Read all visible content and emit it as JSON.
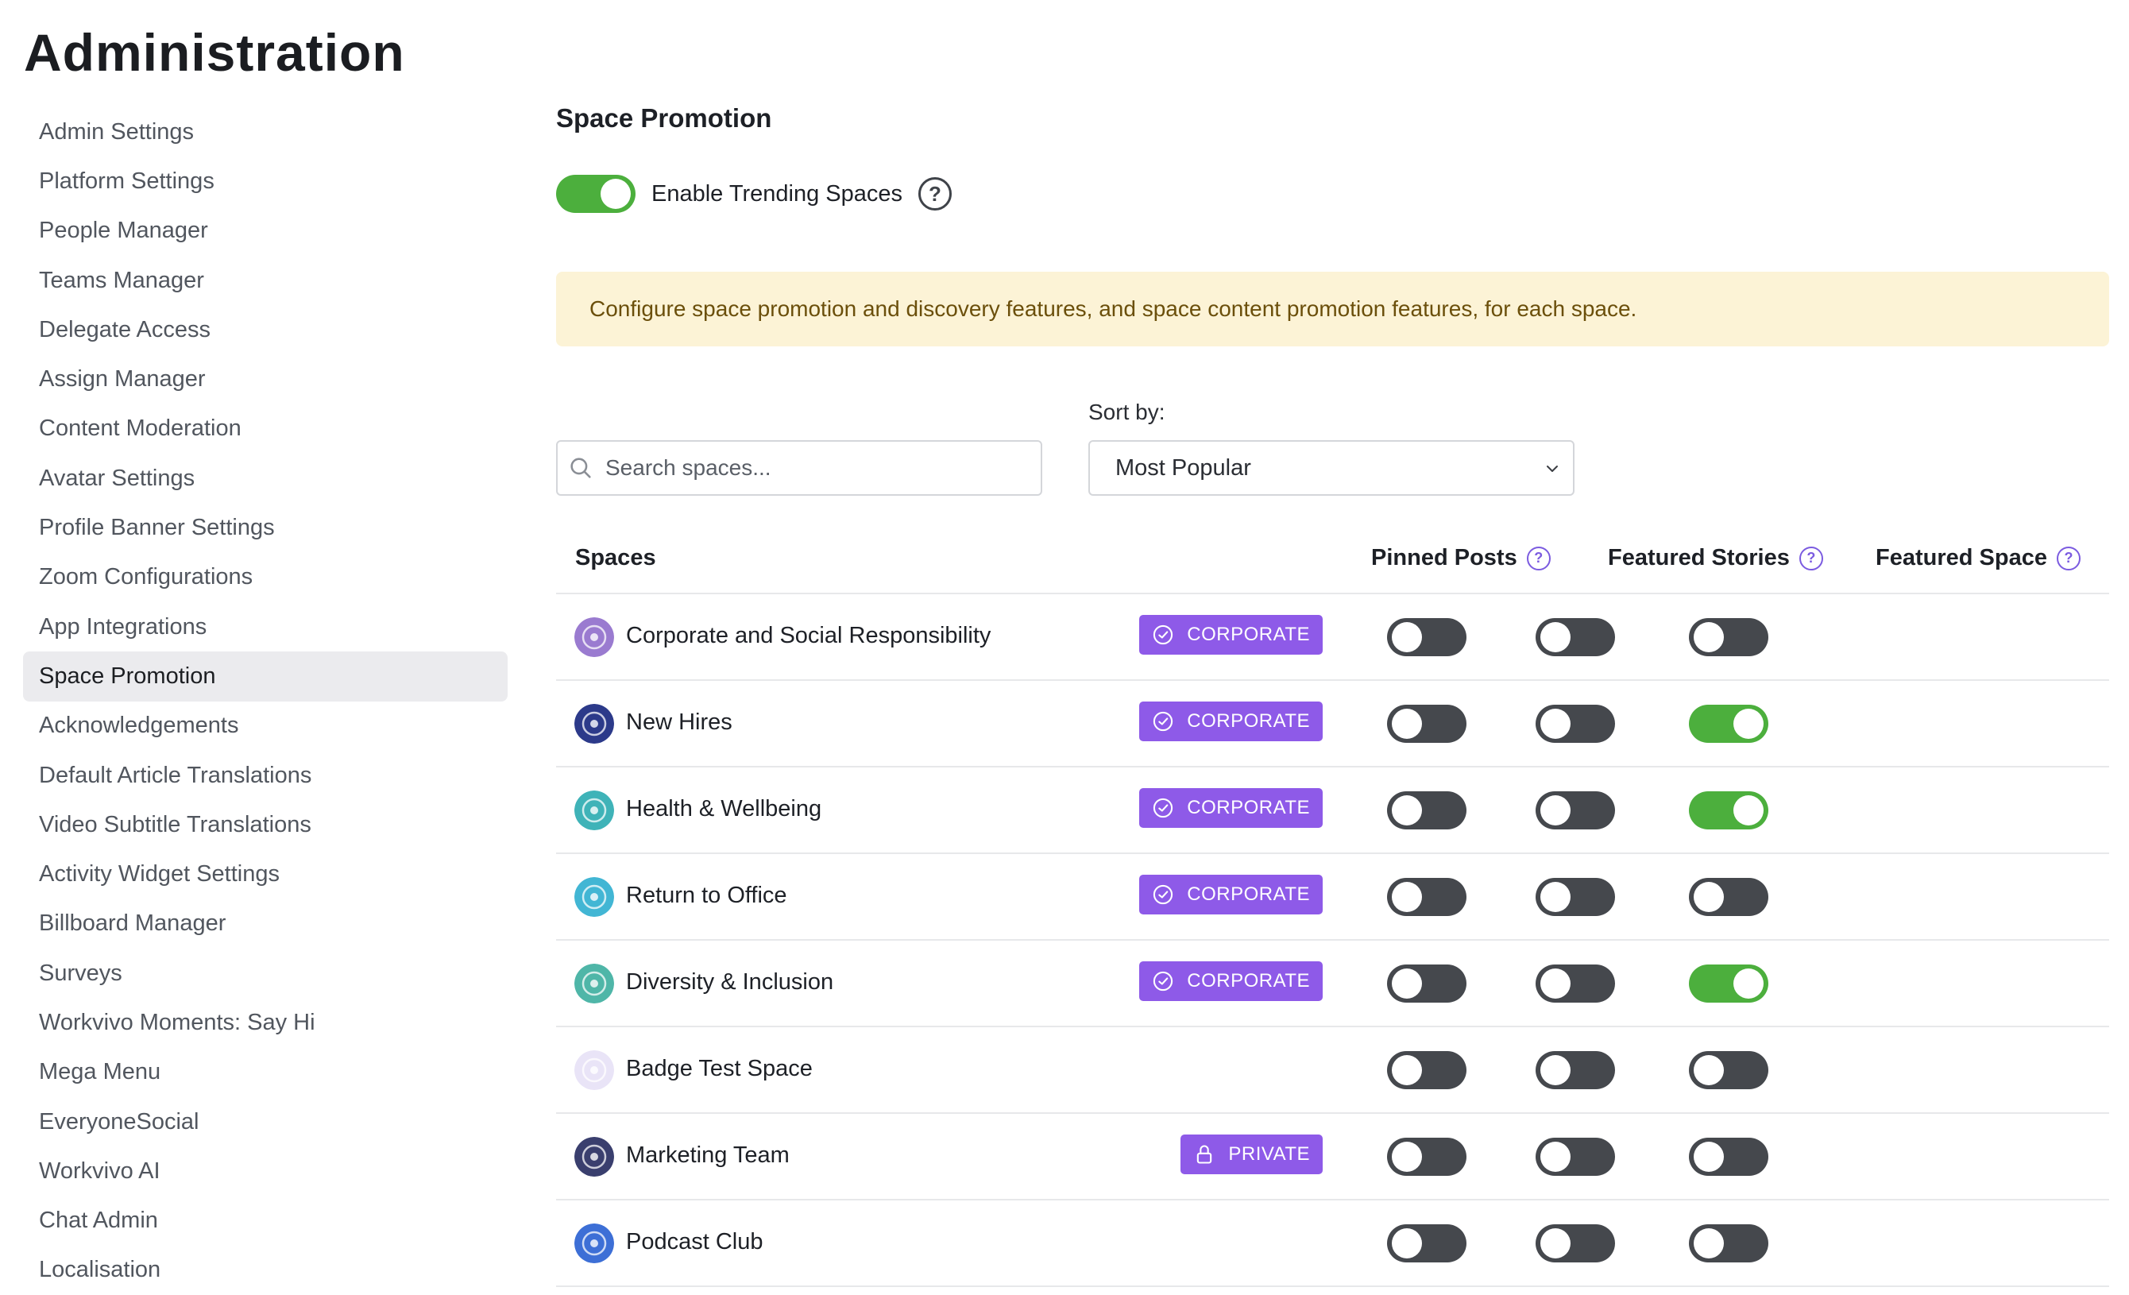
{
  "page_title": "Administration",
  "sidebar": {
    "items": [
      {
        "label": "Admin Settings"
      },
      {
        "label": "Platform Settings"
      },
      {
        "label": "People Manager"
      },
      {
        "label": "Teams Manager"
      },
      {
        "label": "Delegate Access"
      },
      {
        "label": "Assign Manager"
      },
      {
        "label": "Content Moderation"
      },
      {
        "label": "Avatar Settings"
      },
      {
        "label": "Profile Banner Settings"
      },
      {
        "label": "Zoom Configurations"
      },
      {
        "label": "App Integrations"
      },
      {
        "label": "Space Promotion",
        "active": true
      },
      {
        "label": "Acknowledgements"
      },
      {
        "label": "Default Article Translations"
      },
      {
        "label": "Video Subtitle Translations"
      },
      {
        "label": "Activity Widget Settings"
      },
      {
        "label": "Billboard Manager"
      },
      {
        "label": "Surveys"
      },
      {
        "label": "Workvivo Moments: Say Hi"
      },
      {
        "label": "Mega Menu"
      },
      {
        "label": "EveryoneSocial"
      },
      {
        "label": "Workvivo AI"
      },
      {
        "label": "Chat Admin"
      },
      {
        "label": "Localisation"
      }
    ]
  },
  "main": {
    "section_title": "Space Promotion",
    "trending": {
      "label": "Enable Trending Spaces",
      "enabled": true,
      "help_icon": "?"
    },
    "notice": "Configure space promotion and discovery features, and space content promotion features, for each space.",
    "search": {
      "placeholder": "Search spaces...",
      "value": ""
    },
    "sort": {
      "label": "Sort by:",
      "selected": "Most Popular"
    },
    "table": {
      "headers": {
        "spaces": "Spaces",
        "pinned_posts": "Pinned Posts",
        "featured_stories": "Featured Stories",
        "featured_space": "Featured Space",
        "help_icon": "?"
      },
      "rows": [
        {
          "name": "Corporate and Social Responsibility",
          "badge": "CORPORATE",
          "badge_icon": "check-circle-icon",
          "avatar_color": "#9a7bd0",
          "pinned_posts": false,
          "featured_stories": false,
          "featured_space": false
        },
        {
          "name": "New Hires",
          "badge": "CORPORATE",
          "badge_icon": "check-circle-icon",
          "avatar_color": "#2c3a8a",
          "pinned_posts": false,
          "featured_stories": false,
          "featured_space": true
        },
        {
          "name": "Health & Wellbeing",
          "badge": "CORPORATE",
          "badge_icon": "check-circle-icon",
          "avatar_color": "#3fb3b8",
          "pinned_posts": false,
          "featured_stories": false,
          "featured_space": true
        },
        {
          "name": "Return to Office",
          "badge": "CORPORATE",
          "badge_icon": "check-circle-icon",
          "avatar_color": "#42b6d4",
          "pinned_posts": false,
          "featured_stories": false,
          "featured_space": false
        },
        {
          "name": "Diversity & Inclusion",
          "badge": "CORPORATE",
          "badge_icon": "check-circle-icon",
          "avatar_color": "#4fb6a8",
          "pinned_posts": false,
          "featured_stories": false,
          "featured_space": true
        },
        {
          "name": "Badge Test Space",
          "badge": "",
          "badge_icon": "",
          "avatar_color": "#e9e4f7",
          "pinned_posts": false,
          "featured_stories": false,
          "featured_space": false
        },
        {
          "name": "Marketing Team",
          "badge": "PRIVATE",
          "badge_icon": "lock-icon",
          "avatar_color": "#3a3f6e",
          "pinned_posts": false,
          "featured_stories": false,
          "featured_space": false
        },
        {
          "name": "Podcast Club",
          "badge": "",
          "badge_icon": "",
          "avatar_color": "#3d6fd6",
          "pinned_posts": false,
          "featured_stories": false,
          "featured_space": false
        }
      ]
    }
  },
  "colors": {
    "toggle_on": "#4caf3d",
    "toggle_off": "#45484d",
    "badge": "#8e5ae8",
    "notice_bg": "#fcf3d6",
    "notice_text": "#6b4f0b",
    "help_purple": "#7b5be0"
  }
}
